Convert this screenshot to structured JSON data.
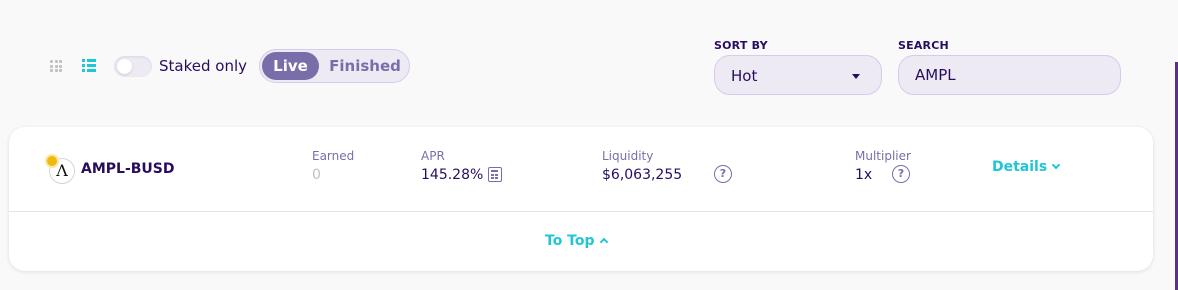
{
  "controls": {
    "staked_only_label": "Staked only",
    "staked_only_on": false,
    "tabs": [
      "Live",
      "Finished"
    ],
    "active_tab": "Live",
    "active_view": "list"
  },
  "sort": {
    "label": "SORT BY",
    "value": "Hot"
  },
  "search": {
    "label": "SEARCH",
    "value": "AMPL"
  },
  "farm": {
    "pair": "AMPL-BUSD",
    "earned_label": "Earned",
    "earned_value": "0",
    "apr_label": "APR",
    "apr_value": "145.28%",
    "liquidity_label": "Liquidity",
    "liquidity_value": "$6,063,255",
    "multiplier_label": "Multiplier",
    "multiplier_value": "1x",
    "details_label": "Details",
    "token_glyph": "Λ"
  },
  "footer": {
    "to_top_label": "To Top"
  },
  "colors": {
    "primary_text": "#280d5f",
    "secondary_text": "#7a6eaa",
    "accent": "#1fc7d4",
    "input_bg": "#eeeaf4"
  }
}
